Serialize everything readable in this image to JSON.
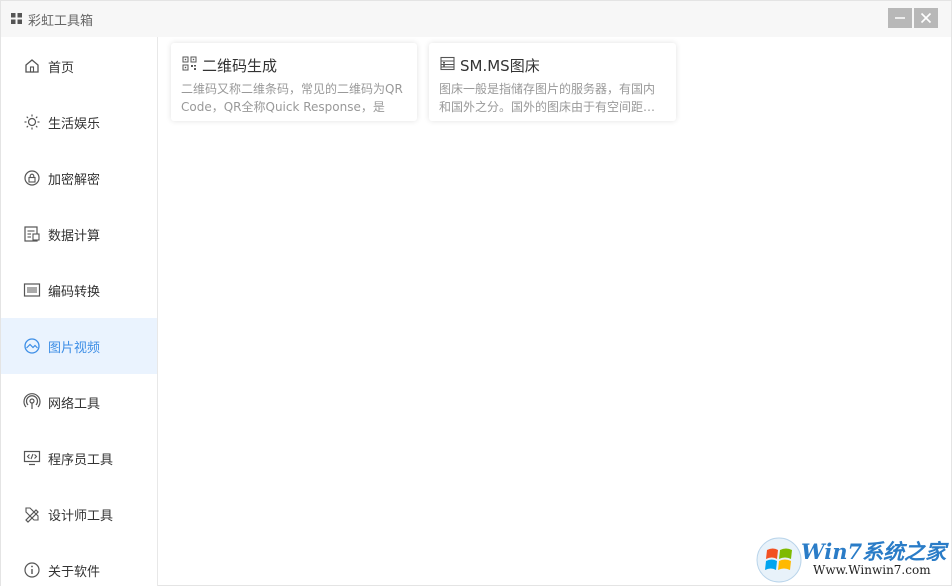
{
  "app": {
    "title": "彩虹工具箱"
  },
  "window_controls": {
    "minimize": "—",
    "close": "✕"
  },
  "sidebar": {
    "items": [
      {
        "label": "首页",
        "icon": "home-icon"
      },
      {
        "label": "生活娱乐",
        "icon": "sun-icon"
      },
      {
        "label": "加密解密",
        "icon": "lock-icon"
      },
      {
        "label": "数据计算",
        "icon": "calculator-icon"
      },
      {
        "label": "编码转换",
        "icon": "barcode-icon"
      },
      {
        "label": "图片视频",
        "icon": "image-icon",
        "active": true
      },
      {
        "label": "网络工具",
        "icon": "network-icon"
      },
      {
        "label": "程序员工具",
        "icon": "code-icon"
      },
      {
        "label": "设计师工具",
        "icon": "design-tools-icon"
      },
      {
        "label": "关于软件",
        "icon": "info-icon"
      }
    ]
  },
  "cards": [
    {
      "title": "二维码生成",
      "desc": "二维码又称二维条码，常见的二维码为QR Code，QR全称Quick Response，是一…",
      "icon": "qrcode-icon"
    },
    {
      "title": "SM.MS图床",
      "desc": "图床一般是指储存图片的服务器，有国内和国外之分。国外的图床由于有空间距…",
      "icon": "image-host-icon"
    }
  ],
  "watermark": {
    "brand": "Win7系统之家",
    "url": "Www.Winwin7.com"
  },
  "colors": {
    "accent": "#3d8ee6",
    "active_bg": "#eaf3fe"
  }
}
